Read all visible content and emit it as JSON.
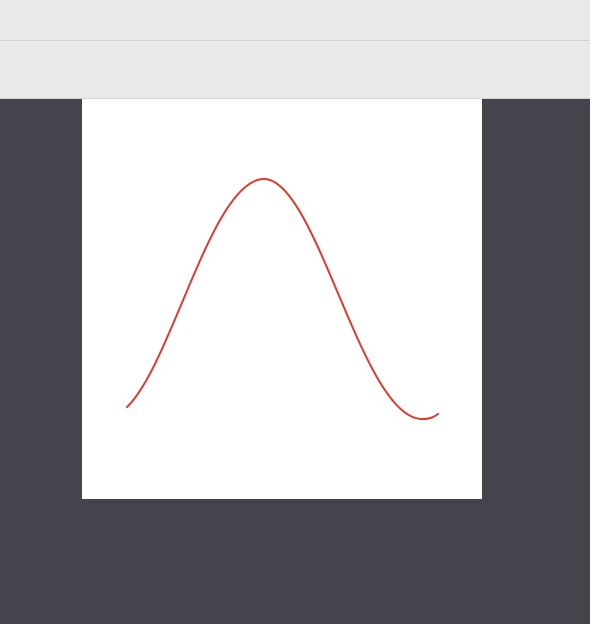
{
  "colors": {
    "toolbar_bg": "#e9e9e9",
    "canvas_bg": "#44444d",
    "artboard_bg": "#ffffff",
    "curve_stroke": "#e0392b"
  },
  "artboard": {
    "shape": "bell-curve-path"
  }
}
